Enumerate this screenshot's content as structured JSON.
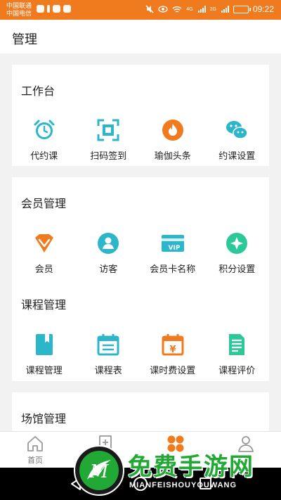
{
  "status_bar": {
    "carrier1": "中国联通",
    "carrier2": "中国电信",
    "net1": "4G",
    "net2": "2G",
    "time": "09:22"
  },
  "header": {
    "title": "管理"
  },
  "workbench": {
    "title": "工作台",
    "items": [
      {
        "label": "代约课",
        "icon": "alarm-clock-icon"
      },
      {
        "label": "扫码签到",
        "icon": "scan-icon"
      },
      {
        "label": "瑜伽头条",
        "icon": "flame-icon"
      },
      {
        "label": "约课设置",
        "icon": "wechat-icon"
      }
    ]
  },
  "members": {
    "title": "会员管理",
    "items": [
      {
        "label": "会员",
        "icon": "diamond-icon"
      },
      {
        "label": "访客",
        "icon": "user-icon"
      },
      {
        "label": "会员卡名称",
        "icon": "vip-card-icon",
        "badge": "VIP"
      },
      {
        "label": "积分设置",
        "icon": "star-icon"
      }
    ]
  },
  "courses": {
    "title": "课程管理",
    "items": [
      {
        "label": "课程管理",
        "icon": "book-icon"
      },
      {
        "label": "课程表",
        "icon": "calendar-icon"
      },
      {
        "label": "课时费设置",
        "icon": "yen-calendar-icon",
        "badge": "¥"
      },
      {
        "label": "课程评价",
        "icon": "document-icon"
      }
    ]
  },
  "venue": {
    "title": "场馆管理"
  },
  "bottom_nav": {
    "items": [
      {
        "label": "首页",
        "icon": "home-icon"
      },
      {
        "label": "",
        "icon": "bookmark-icon"
      },
      {
        "label": "",
        "icon": "grid-icon"
      },
      {
        "label": "我",
        "icon": "profile-icon"
      }
    ]
  },
  "watermark": {
    "text": "免费手游网",
    "sub": "MIANFEISHOUYOUWANG"
  },
  "colors": {
    "statusbar": "#f07a1e",
    "accent": "#f07a1e",
    "teal": "#2bb6c9",
    "green": "#22a834"
  }
}
